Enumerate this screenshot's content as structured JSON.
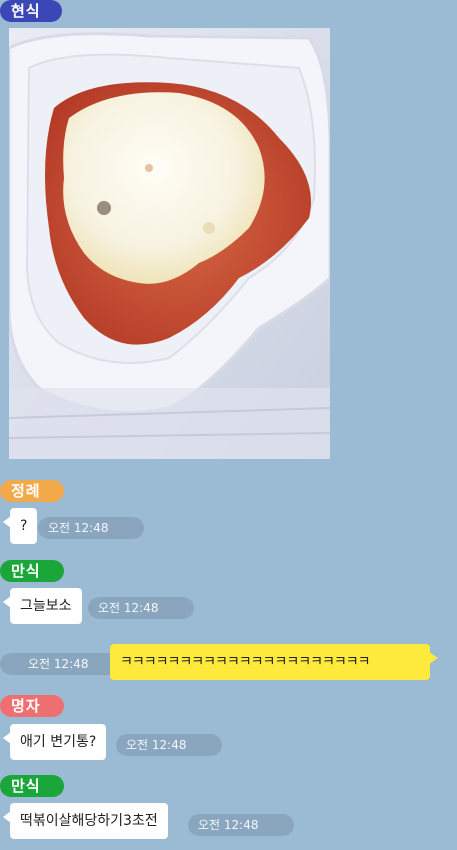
{
  "colors": {
    "background": "#9bbbd4",
    "name_hyunsik": "#3b47b6",
    "name_jeongrye": "#f1a94a",
    "name_mansik": "#1ba63a",
    "name_myeongja": "#ee6f6f",
    "my_bubble": "#fdea3d"
  },
  "messages": [
    {
      "sender": "현식",
      "type": "image",
      "image_alt": "icon-food-photo"
    },
    {
      "sender": "정례",
      "text": "?",
      "time": "오전 12:48"
    },
    {
      "sender": "만식",
      "text": "그늘보소",
      "time": "오전 12:48"
    },
    {
      "sender": "me",
      "text": "ㅋㅋㅋㅋㅋㅋㅋㅋㅋㅋㅋㅋㅋㅋㅋㅋㅋㅋㅋㅋㅋ",
      "time": "오전 12:48"
    },
    {
      "sender": "명자",
      "text": "애기 변기통?",
      "time": "오전 12:48"
    },
    {
      "sender": "만식",
      "text": "떡볶이살해당하기3초전",
      "time": "오전 12:48"
    }
  ]
}
